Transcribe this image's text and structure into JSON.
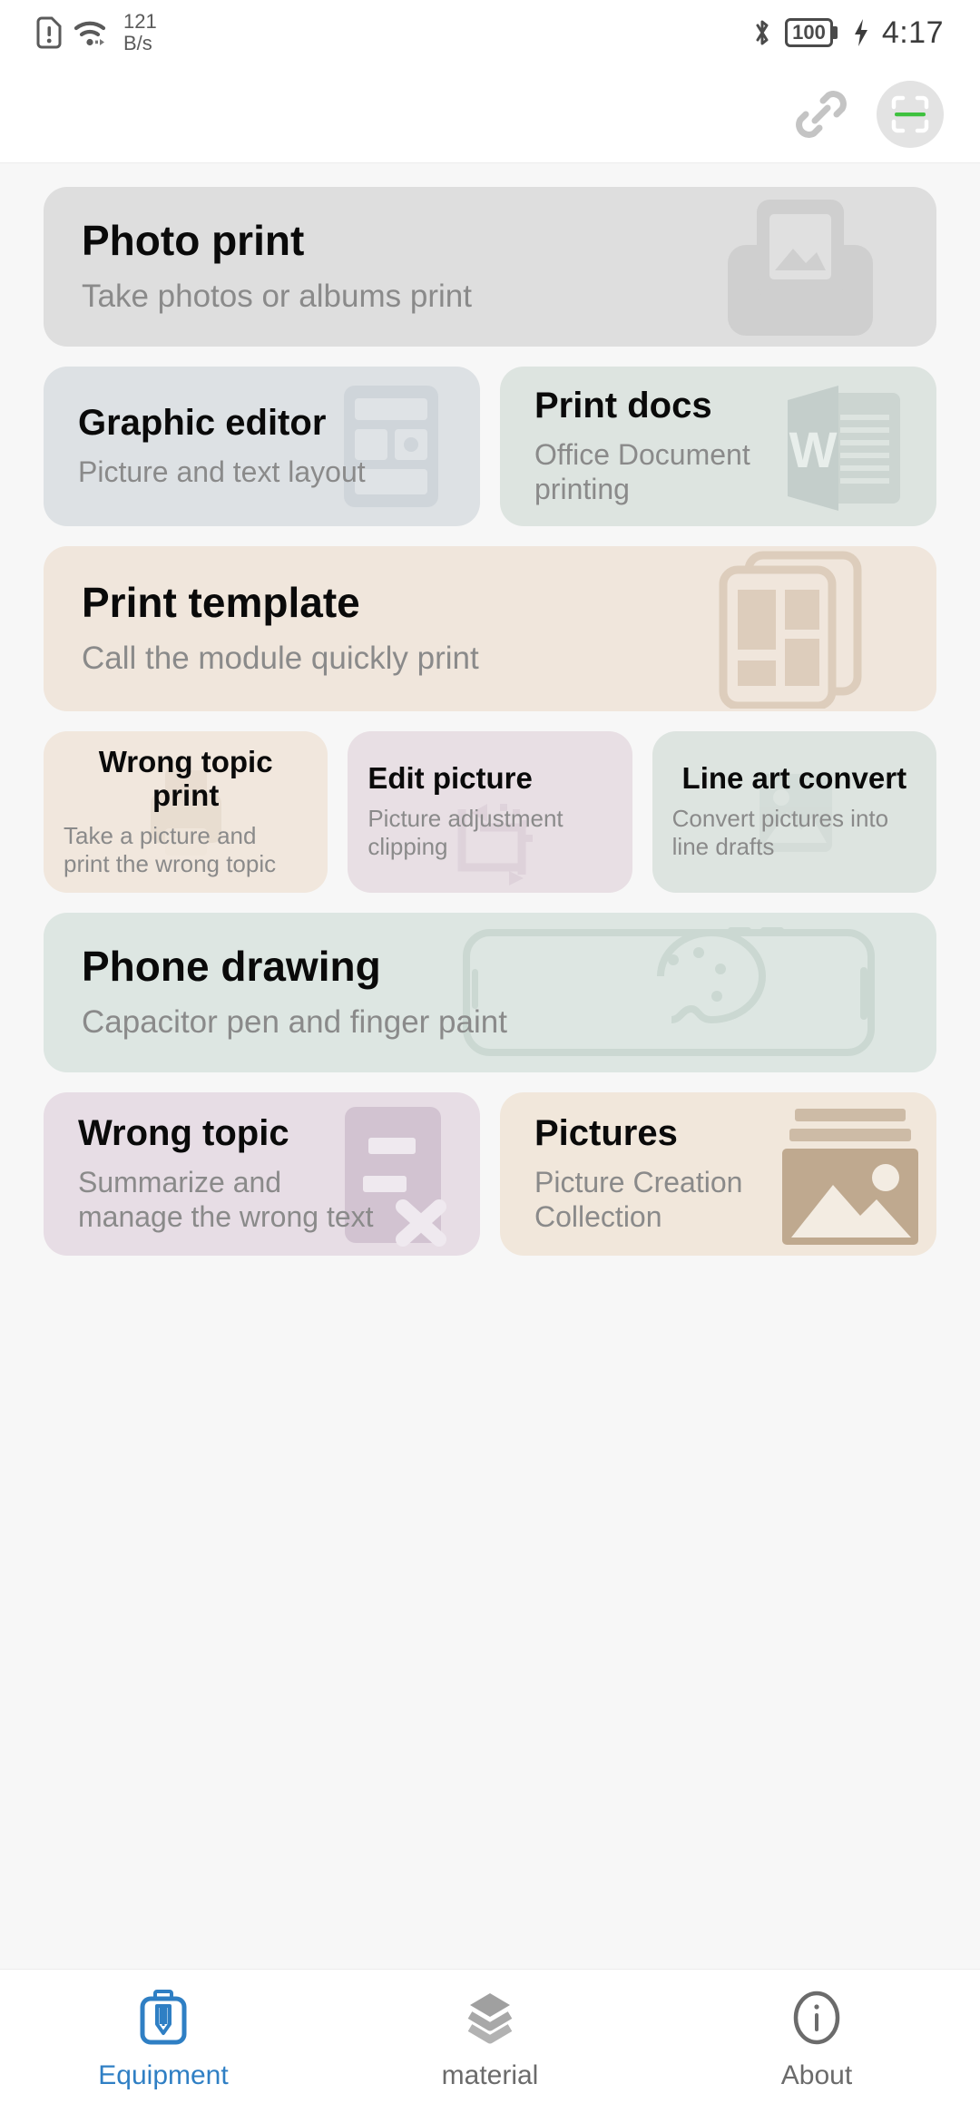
{
  "statusbar": {
    "sim_icon": "sim-alert-icon",
    "wifi_icon": "wifi-icon",
    "net_speed_value": "121",
    "net_speed_unit": "B/s",
    "bluetooth_icon": "bluetooth-icon",
    "battery_level": "100",
    "charging_icon": "charging-bolt-icon",
    "time": "4:17"
  },
  "appbar": {
    "link_icon": "link-chain-icon",
    "scan_icon": "scan-qr-icon",
    "scan_line_color": "#3ec13e"
  },
  "cards": [
    {
      "title": "Photo print",
      "sub": "Take photos or albums print",
      "bg": "#dedede",
      "art_color": "#cfcfcf",
      "icon": "printer-photo-icon"
    },
    {
      "title": "Graphic editor",
      "sub": "Picture and text layout",
      "bg": "#dde1e4",
      "art_color": "#cfd5da",
      "icon": "layout-editor-icon"
    },
    {
      "title": "Print docs",
      "sub": "Office Document printing",
      "bg": "#dde4e0",
      "art_color": "#ccd5d1",
      "icon": "word-document-icon"
    },
    {
      "title": "Print template",
      "sub": "Call the module quickly print",
      "bg": "#f0e6dc",
      "art_color": "#ddcdbc",
      "icon": "template-grid-icon"
    },
    {
      "title": "Wrong topic print",
      "sub": "Take a picture and print the wrong topic",
      "bg": "#f1e7dd",
      "art_color": "#e2d5c7",
      "icon": "printer-icon"
    },
    {
      "title": "Edit picture",
      "sub": "Picture adjustment clipping",
      "bg": "#e8dfe4",
      "art_color": "#d6c9d3",
      "icon": "crop-rotate-icon"
    },
    {
      "title": "Line art convert",
      "sub": "Convert pictures into line drafts",
      "bg": "#dde4e0",
      "art_color": "#ccd5d1",
      "icon": "image-outline-icon"
    },
    {
      "title": "Phone drawing",
      "sub": "Capacitor pen and finger paint",
      "bg": "#dde6e2",
      "art_color": "#cbd8d2",
      "icon": "phone-palette-icon"
    },
    {
      "title": "Wrong topic",
      "sub": "Summarize and manage the wrong text",
      "bg": "#e7dde5",
      "art_color": "#d2c3d1",
      "icon": "document-x-icon"
    },
    {
      "title": "Pictures",
      "sub": "Picture Creation Collection",
      "bg": "#f1e7db",
      "art_color": "#cdbba6",
      "icon": "photo-stack-icon"
    }
  ],
  "tabbar": {
    "items": [
      {
        "label": "Equipment",
        "icon": "printer-pen-icon",
        "active": true,
        "color": "#2f7fc4"
      },
      {
        "label": "material",
        "icon": "layers-icon",
        "active": false,
        "color": "#8c8c8c"
      },
      {
        "label": "About",
        "icon": "info-circle-icon",
        "active": false,
        "color": "#6b6b6b"
      }
    ]
  }
}
